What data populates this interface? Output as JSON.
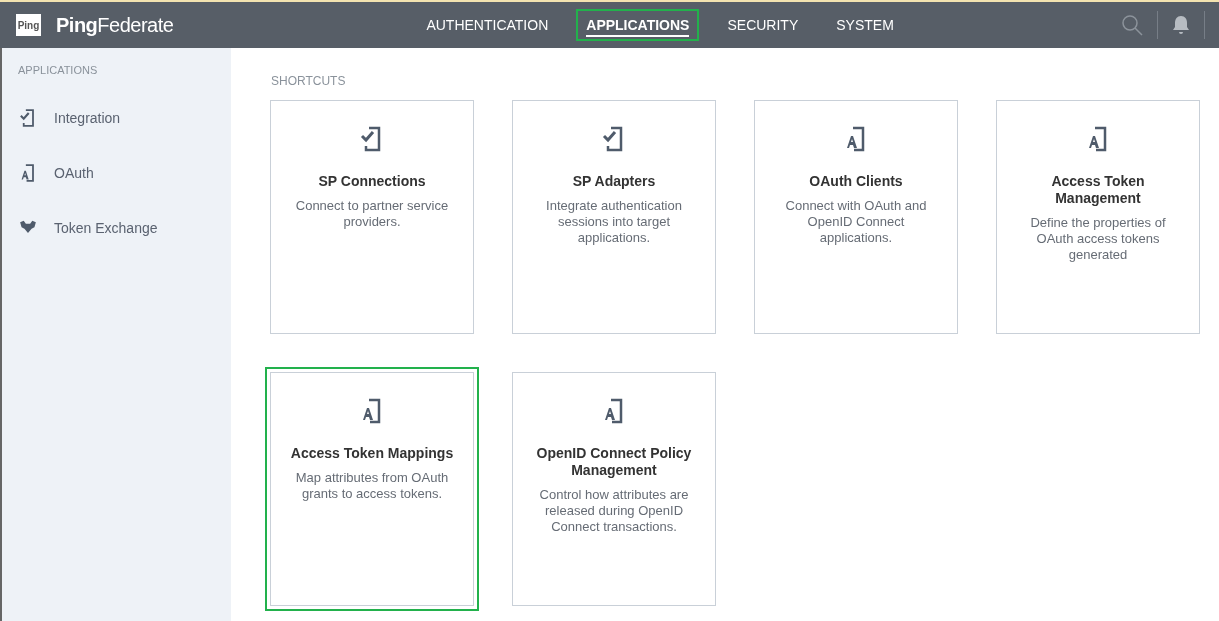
{
  "header": {
    "logo": "Ping",
    "brand": "**Ping**Federate",
    "nav": [
      {
        "label": "AUTHENTICATION",
        "selected": false,
        "highlighted": false
      },
      {
        "label": "APPLICATIONS",
        "selected": true,
        "highlighted": true
      },
      {
        "label": "SECURITY",
        "selected": false,
        "highlighted": false
      },
      {
        "label": "SYSTEM",
        "selected": false,
        "highlighted": false
      }
    ]
  },
  "sidebar": {
    "heading": "APPLICATIONS",
    "items": [
      {
        "label": "Integration",
        "kind": "check"
      },
      {
        "label": "OAuth",
        "kind": "oauth"
      },
      {
        "label": "Token Exchange",
        "kind": "exchange"
      }
    ]
  },
  "shortcuts": {
    "heading": "SHORTCUTS",
    "cards": [
      {
        "title": "SP Connections",
        "description": "Connect to partner service providers.",
        "kind": "check",
        "highlighted": false
      },
      {
        "title": "SP Adapters",
        "description": "Integrate authentication sessions into target applications.",
        "kind": "check",
        "highlighted": false
      },
      {
        "title": "OAuth Clients",
        "description": "Connect with OAuth and OpenID Connect applications.",
        "kind": "oauth",
        "highlighted": false
      },
      {
        "title": "Access Token Management",
        "description": "Define the properties of OAuth access tokens generated",
        "kind": "oauth",
        "highlighted": false
      },
      {
        "title": "Access Token Mappings",
        "description": "Map attributes from OAuth grants to access tokens.",
        "kind": "oauth",
        "highlighted": true
      },
      {
        "title": "OpenID Connect Policy Management",
        "description": "Control how attributes are released during OpenID Connect transactions.",
        "kind": "oauth",
        "highlighted": false
      }
    ]
  }
}
